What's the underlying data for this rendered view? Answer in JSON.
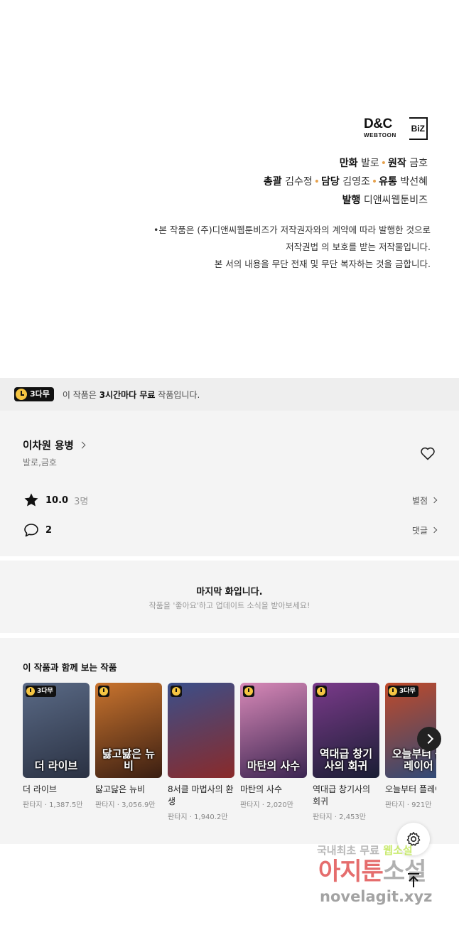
{
  "credits": {
    "logo_main": "D&C",
    "logo_sub": "WEBTOON",
    "logo_biz": "BiZ",
    "line1": [
      {
        "label": "만화",
        "value": "발로"
      },
      {
        "label": "원작",
        "value": "금호"
      }
    ],
    "line2": [
      {
        "label": "총괄",
        "value": "김수정"
      },
      {
        "label": "담당",
        "value": "김영조"
      },
      {
        "label": "유통",
        "value": "박선혜"
      }
    ],
    "line3": [
      {
        "label": "발행",
        "value": "디앤씨웹툰비즈"
      }
    ],
    "separator": "•",
    "notice": [
      "•본 작품은 (주)디앤씨웹툰비즈가 저작권자와의 계약에 따라 발행한 것으로",
      "저작권법 의 보호를 받는 저작물입니다.",
      "본 서의 내용을 무단 전재 및 무단 복자하는 것을 금합니다."
    ]
  },
  "free_banner": {
    "badge": "3다무",
    "text_before": "이 작품은 ",
    "text_bold": "3시간마다 무료",
    "text_after": " 작품입니다."
  },
  "work": {
    "title": "이차원 용병",
    "authors": "발로,금호",
    "rating": "10.0",
    "rating_count": "3명",
    "rating_link": "별점",
    "comments": "2",
    "comments_link": "댓글"
  },
  "last_episode": {
    "title": "마지막 화입니다.",
    "subtitle": "작품을 '좋아요'하고 업데이트 소식을 받아보세요!"
  },
  "recommendations": {
    "heading": "이 작품과 함께 보는 작품",
    "items": [
      {
        "title": "더 라이브",
        "thumb_text": "더 라이브",
        "genre": "판타지",
        "views": "1,387.5만",
        "badge": "3다무",
        "colors": [
          "#5a6a86",
          "#2a3142"
        ]
      },
      {
        "title": "닳고닳은 뉴비",
        "thumb_text": "닳고닳은 뉴비",
        "genre": "판타지",
        "views": "3,056.9만",
        "badge": "",
        "colors": [
          "#c9742e",
          "#3a1e12"
        ]
      },
      {
        "title": "8서클 마법사의 환생",
        "thumb_text": "",
        "genre": "판타지",
        "views": "1,940.2만",
        "badge": "",
        "colors": [
          "#3a4f8a",
          "#8a2a2a"
        ]
      },
      {
        "title": "마탄의 사수",
        "thumb_text": "마탄의 사수",
        "genre": "판타지",
        "views": "2,020만",
        "badge": "",
        "colors": [
          "#d889b8",
          "#3a2450"
        ]
      },
      {
        "title": "역대급 창기사의 회귀",
        "thumb_text": "역대급 창기사의 회귀",
        "genre": "판타지",
        "views": "2,453만",
        "badge": "",
        "colors": [
          "#7a3a8a",
          "#1a1e34"
        ]
      },
      {
        "title": "오늘부터 플레이어",
        "thumb_text": "오늘부터 플레이어",
        "genre": "판타지",
        "views": "921만",
        "badge": "3다무",
        "colors": [
          "#c04a2a",
          "#2a4a7a"
        ]
      }
    ]
  },
  "watermark": {
    "line1_a": "국내최초 무료 ",
    "line1_b": "웹소설",
    "line2_a": "아지툰",
    "line2_b": "소설",
    "line3": "novelagit.xyz"
  }
}
